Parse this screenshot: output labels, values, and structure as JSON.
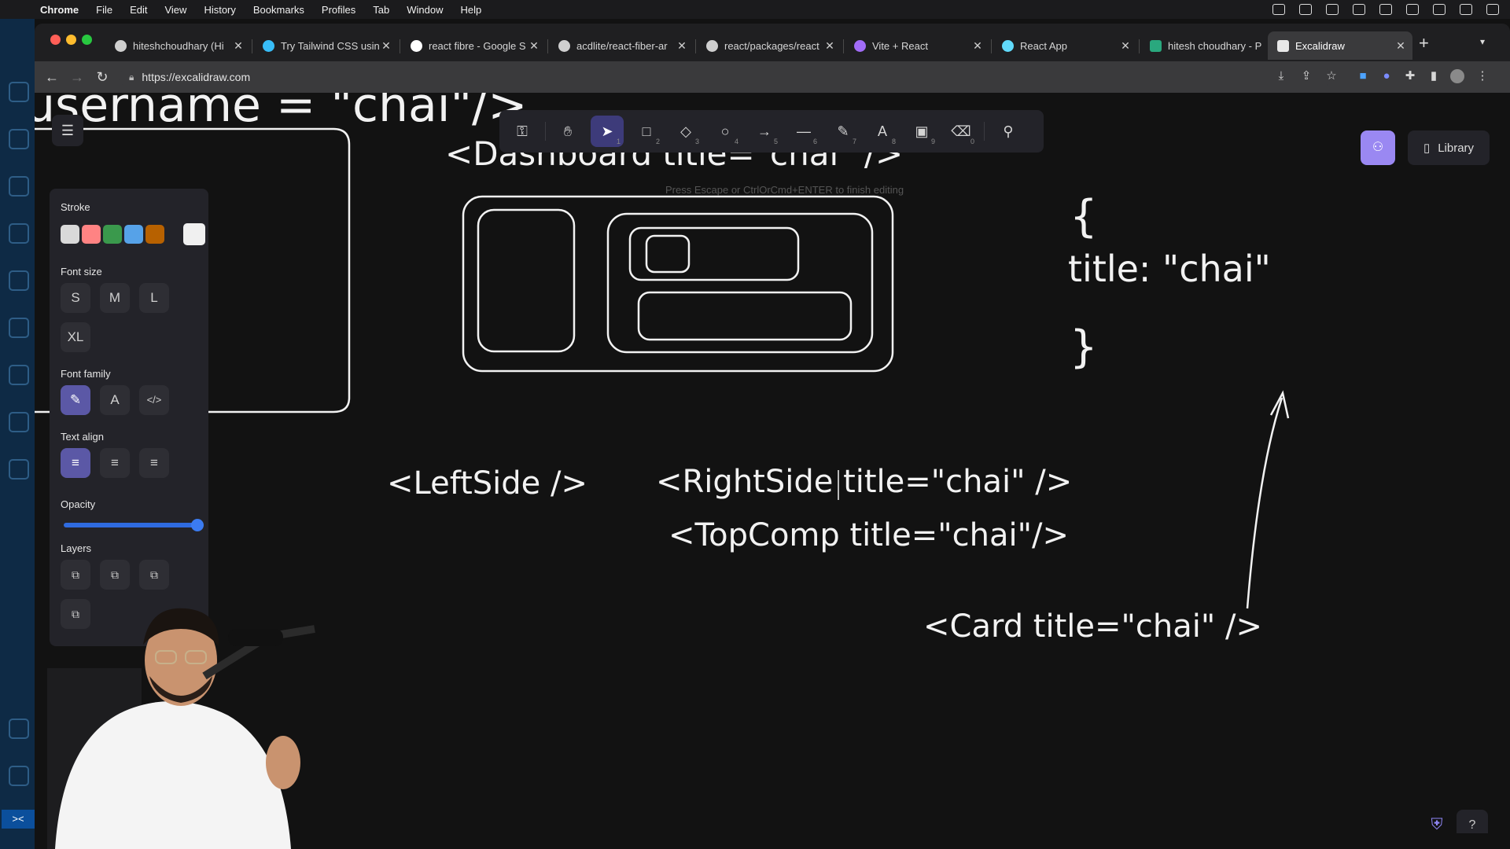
{
  "menubar": {
    "items": [
      "Chrome",
      "File",
      "Edit",
      "View",
      "History",
      "Bookmarks",
      "Profiles",
      "Tab",
      "Window",
      "Help"
    ]
  },
  "tabs": [
    {
      "label": "hiteshchoudhary (Hi"
    },
    {
      "label": "Try Tailwind CSS usin"
    },
    {
      "label": "react fibre - Google S"
    },
    {
      "label": "acdlite/react-fiber-ar"
    },
    {
      "label": "react/packages/react"
    },
    {
      "label": "Vite + React"
    },
    {
      "label": "React App"
    },
    {
      "label": "hitesh choudhary - P"
    },
    {
      "label": "Excalidraw"
    }
  ],
  "address": {
    "url": "https://excalidraw.com"
  },
  "props": {
    "stroke_label": "Stroke",
    "stroke_colors": [
      "#d9d9d9",
      "#ff8383",
      "#3a994c",
      "#56a2e8",
      "#b76100"
    ],
    "current_stroke": "#f0f0f0",
    "font_size_label": "Font size",
    "font_sizes": [
      "S",
      "M",
      "L",
      "XL"
    ],
    "font_family_label": "Font family",
    "text_align_label": "Text align",
    "opacity_label": "Opacity",
    "opacity_value": 100,
    "layers_label": "Layers"
  },
  "tools": [
    {
      "name": "lock",
      "key": ""
    },
    {
      "name": "hand",
      "key": ""
    },
    {
      "name": "selection",
      "key": "1"
    },
    {
      "name": "rectangle",
      "key": "2"
    },
    {
      "name": "diamond",
      "key": "3"
    },
    {
      "name": "ellipse",
      "key": "4"
    },
    {
      "name": "arrow",
      "key": "5"
    },
    {
      "name": "line",
      "key": "6"
    },
    {
      "name": "draw",
      "key": "7"
    },
    {
      "name": "text",
      "key": "8"
    },
    {
      "name": "image",
      "key": "9"
    },
    {
      "name": "eraser",
      "key": "0"
    },
    {
      "name": "extra-tools",
      "key": ""
    }
  ],
  "hint": "Press Escape or CtrlOrCmd+ENTER to finish editing",
  "library_label": "Library",
  "canvas_text": {
    "top_partial": "username = \"chai\"/>",
    "dashboard": "<Dashboard title=\"chai\" />",
    "brace_open": "{",
    "title_prop": "title: \"chai\"",
    "brace_close": "}",
    "leftside": "<LeftSide />",
    "rightside": "<RightSide title=\"chai\" />",
    "topcomp": "<TopComp  title=\"chai\"/>",
    "card": "<Card title=\"chai\" />"
  },
  "vscode_badge": "><"
}
